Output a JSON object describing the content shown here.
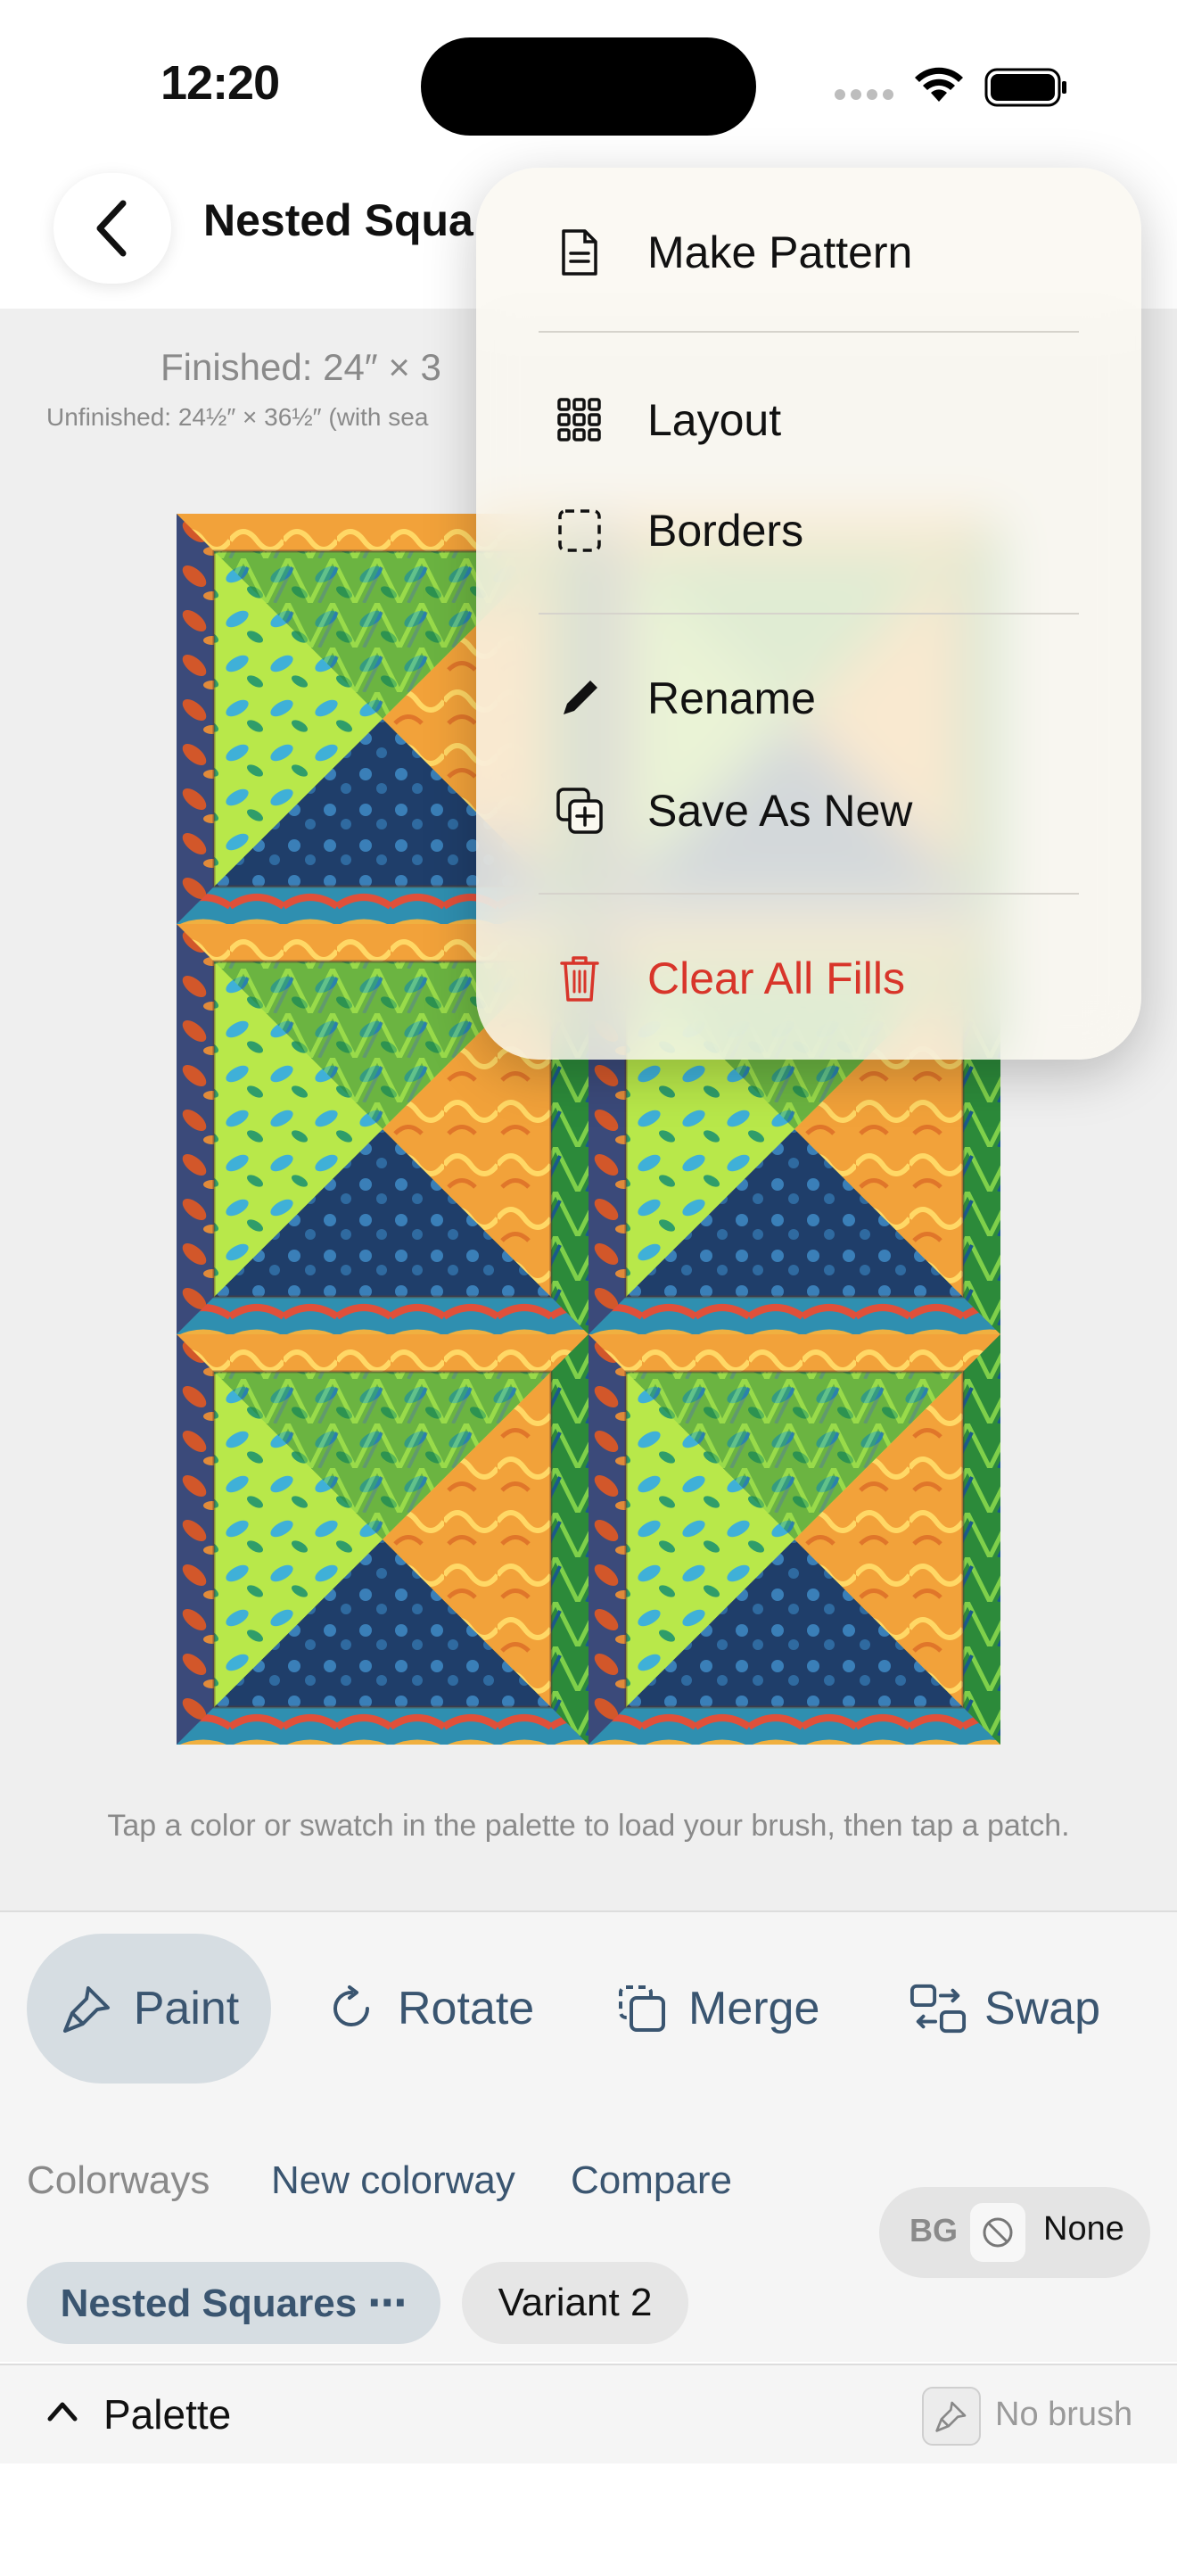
{
  "status_bar": {
    "time": "12:20"
  },
  "header": {
    "title": "Nested Squa"
  },
  "canvas": {
    "finished_text": "Finished: 24″ × 3",
    "unfinished_text": "Unfinished: 24½″ × 36½″ (with sea",
    "hint": "Tap a color or swatch in the palette to load your brush, then tap a patch."
  },
  "menu": {
    "items": [
      {
        "label": "Make Pattern",
        "icon": "document-icon"
      },
      {
        "label": "Layout",
        "icon": "grid-icon"
      },
      {
        "label": "Borders",
        "icon": "dashed-square-icon"
      },
      {
        "label": "Rename",
        "icon": "pencil-icon"
      },
      {
        "label": "Save As New",
        "icon": "plus-copy-icon"
      },
      {
        "label": "Clear All Fills",
        "icon": "trash-icon",
        "color": "#d8352a"
      }
    ]
  },
  "toolbar": {
    "paint": "Paint",
    "rotate": "Rotate",
    "merge": "Merge",
    "swap": "Swap"
  },
  "colorways": {
    "label": "Colorways",
    "new_colorway": "New colorway",
    "compare": "Compare",
    "bg_label": "BG",
    "bg_value": "None",
    "chips": [
      "Nested Squares ⋯",
      "Variant 2"
    ]
  },
  "palette": {
    "label": "Palette",
    "brush_status": "No brush"
  },
  "colors": {
    "accent": "#3a5570",
    "danger": "#d8352a",
    "active_chip_bg": "#d6dde2"
  }
}
